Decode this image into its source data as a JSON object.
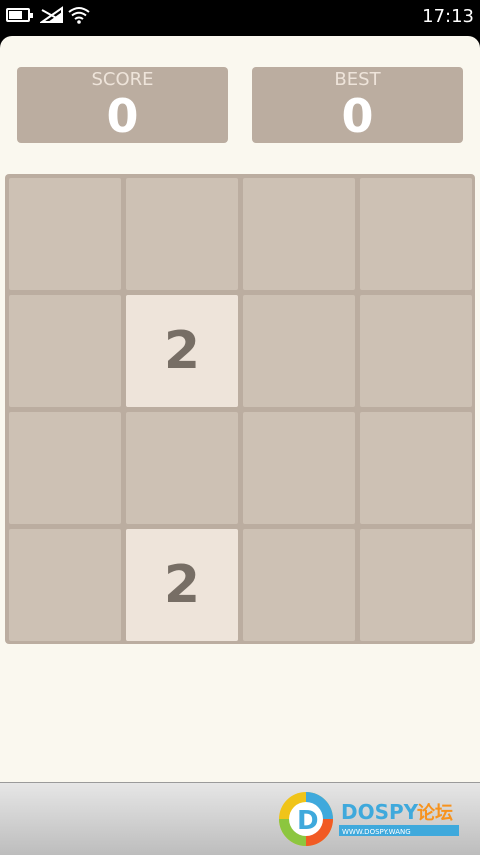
{
  "status_bar": {
    "time": "17:13",
    "icons": [
      "battery-icon",
      "no-sim-icon",
      "wifi-icon"
    ]
  },
  "scores": {
    "score_label": "SCORE",
    "score_value": "0",
    "best_label": "BEST",
    "best_value": "0"
  },
  "board": {
    "rows": [
      [
        "",
        "",
        "",
        ""
      ],
      [
        "",
        "2",
        "",
        ""
      ],
      [
        "",
        "",
        "",
        ""
      ],
      [
        "",
        "2",
        "",
        ""
      ]
    ]
  },
  "watermark": {
    "brand": "DOSPY",
    "brand_cn": "论坛",
    "url": "WWW.DOSPY.WANG"
  },
  "colors": {
    "background": "#faf8ef",
    "board": "#bbada0",
    "empty_cell": "#cdc1b4",
    "tile_2": "#eee4da",
    "tile_text": "#776e65"
  }
}
